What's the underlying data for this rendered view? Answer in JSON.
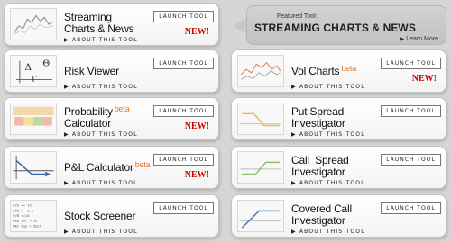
{
  "common": {
    "launch_label": "LAUNCH TOOL",
    "about_label": "ABOUT THIS TOOL",
    "about_arrow": "▶",
    "new_label": "NEW!",
    "beta_label": "beta"
  },
  "featured": {
    "label": "Featured Tool:",
    "title": "STREAMING CHARTS & NEWS",
    "learn_more": "Learn More",
    "arrow": "▶"
  },
  "tools": [
    {
      "id": "streaming",
      "line1": "Streaming",
      "line2": "Charts & News",
      "beta": false,
      "is_new": true,
      "thumb_icon": "streaming-chart-icon"
    },
    {
      "id": "risk-viewer",
      "line1": "Risk Viewer",
      "beta": false,
      "is_new": false,
      "thumb_icon": "greek-symbols-icon",
      "thumb_text": [
        "Δ",
        "Γ",
        "Θ"
      ]
    },
    {
      "id": "probability",
      "line1": "Probability",
      "line2": "Calculator",
      "beta": true,
      "is_new": true,
      "thumb_icon": "probability-bar-icon"
    },
    {
      "id": "pl-calculator",
      "line1": "P&L Calculator",
      "beta": true,
      "is_new": true,
      "thumb_icon": "pl-graph-icon"
    },
    {
      "id": "stock-screener",
      "line1": "Stock Screener",
      "beta": false,
      "is_new": false,
      "thumb_icon": "screener-list-icon",
      "thumb_text": [
        "P/E <= 15",
        "EPS >= 1.5",
        "P/B <=15",
        "Dep Vol > 5k",
        "Mkt Cap > 5bil"
      ]
    },
    {
      "id": "vol-charts",
      "line1": "Vol Charts",
      "beta": true,
      "is_new": true,
      "thumb_icon": "vol-chart-icon"
    },
    {
      "id": "put-spread",
      "line1": "Put Spread",
      "line2": "Investigator",
      "beta": false,
      "is_new": false,
      "thumb_icon": "put-spread-icon"
    },
    {
      "id": "call-spread",
      "line1": "Call  Spread",
      "line2": "Investigator",
      "beta": false,
      "is_new": false,
      "thumb_icon": "call-spread-icon"
    },
    {
      "id": "covered-call",
      "line1": "Covered Call",
      "line2": "Investigator",
      "beta": false,
      "is_new": false,
      "thumb_icon": "covered-call-icon"
    }
  ],
  "colors": {
    "beta": "#e87722",
    "new": "#cc0000",
    "card_bg": "#ffffff",
    "page_bg": "#d6d6d6"
  }
}
